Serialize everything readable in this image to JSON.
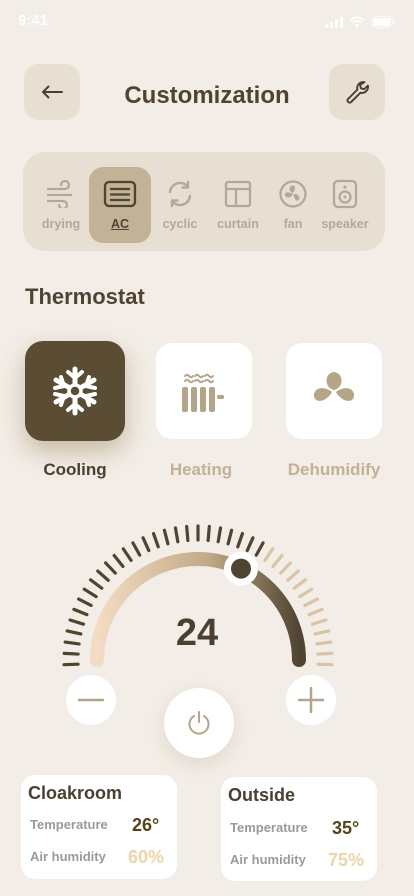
{
  "status_bar": {
    "time": "9:41"
  },
  "header": {
    "title": "Customization"
  },
  "modes": [
    {
      "label": "drying",
      "icon": "wind-icon",
      "active": false
    },
    {
      "label": "AC",
      "icon": "ac-unit-icon",
      "active": true
    },
    {
      "label": "cyclic",
      "icon": "refresh-icon",
      "active": false
    },
    {
      "label": "curtain",
      "icon": "curtain-icon",
      "active": false
    },
    {
      "label": "fan",
      "icon": "fan-icon",
      "active": false
    },
    {
      "label": "speaker",
      "icon": "speaker-icon",
      "active": false
    }
  ],
  "thermostat": {
    "title": "Thermostat",
    "options": [
      {
        "label": "Cooling",
        "icon": "snowflake-icon",
        "active": true
      },
      {
        "label": "Heating",
        "icon": "radiator-icon",
        "active": false
      },
      {
        "label": "Dehumidify",
        "icon": "dehumidify-icon",
        "active": false
      }
    ],
    "temperature": "24",
    "dial_level": 0.64
  },
  "rooms": [
    {
      "name": "Cloakroom",
      "temperature_label": "Temperature",
      "temperature": "26°",
      "humidity_label": "Air humidity",
      "humidity": "60%"
    },
    {
      "name": "Outside",
      "temperature_label": "Temperature",
      "temperature": "35°",
      "humidity_label": "Air humidity",
      "humidity": "75%"
    }
  ],
  "colors": {
    "background": "#f2ede6",
    "accent_dark": "#5a4d34",
    "accent_light": "#c2b296",
    "humidity_value": "#f2d3a6",
    "temperature_value": "#5a4216"
  }
}
